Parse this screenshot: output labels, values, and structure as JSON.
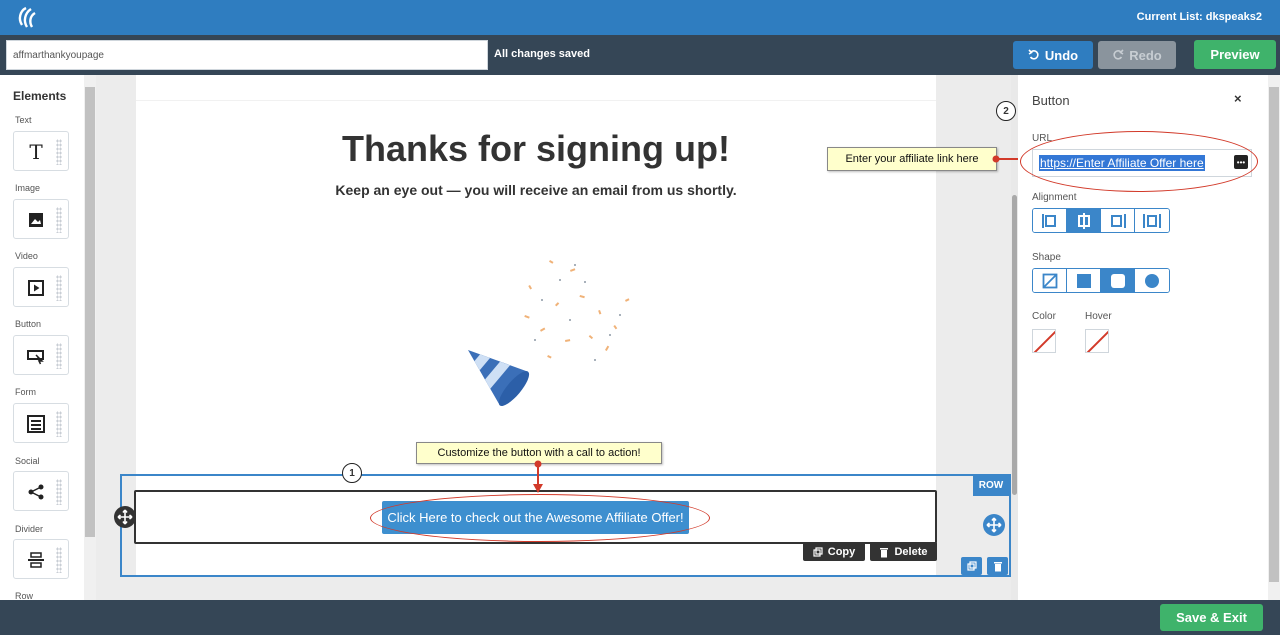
{
  "topbar": {
    "current_list_label": "Current List: dkspeaks2"
  },
  "toolbar": {
    "page_name_value": "affmarthankyoupage",
    "status": "All changes saved",
    "undo_label": "Undo",
    "redo_label": "Redo",
    "preview_label": "Preview"
  },
  "elements": {
    "title": "Elements",
    "items": [
      {
        "label": "Text",
        "icon": "text-icon"
      },
      {
        "label": "Image",
        "icon": "image-icon"
      },
      {
        "label": "Video",
        "icon": "video-icon"
      },
      {
        "label": "Button",
        "icon": "button-icon"
      },
      {
        "label": "Form",
        "icon": "form-icon"
      },
      {
        "label": "Social",
        "icon": "share-icon"
      },
      {
        "label": "Divider",
        "icon": "divider-icon"
      },
      {
        "label": "Row",
        "icon": "row-icon"
      }
    ]
  },
  "canvas": {
    "headline": "Thanks for signing up!",
    "subline": "Keep an eye out — you will receive an email from us shortly.",
    "cta_label": "Click Here to check out the Awesome Affiliate Offer!",
    "row_tag": "ROW",
    "copy_label": "Copy",
    "delete_label": "Delete"
  },
  "callouts": {
    "step1_number": "1",
    "step1_text": "Customize the button with a call to action!",
    "step2_number": "2",
    "step2_text": "Enter your affiliate link here"
  },
  "panel": {
    "title": "Button",
    "close": "×",
    "url_label": "URL",
    "url_value": "https://Enter Affiliate Offer here",
    "alignment_label": "Alignment",
    "shape_label": "Shape",
    "color_label": "Color",
    "hover_label": "Hover",
    "alignment_selected": "center",
    "shape_selected": "rounded"
  },
  "footer": {
    "save_exit_label": "Save & Exit"
  },
  "colors": {
    "brand_blue": "#2f7dc0",
    "toolbar_dark": "#354656",
    "success_green": "#3fb36b",
    "annotation_red": "#d23a2a",
    "callout_yellow": "#ffffcc"
  }
}
